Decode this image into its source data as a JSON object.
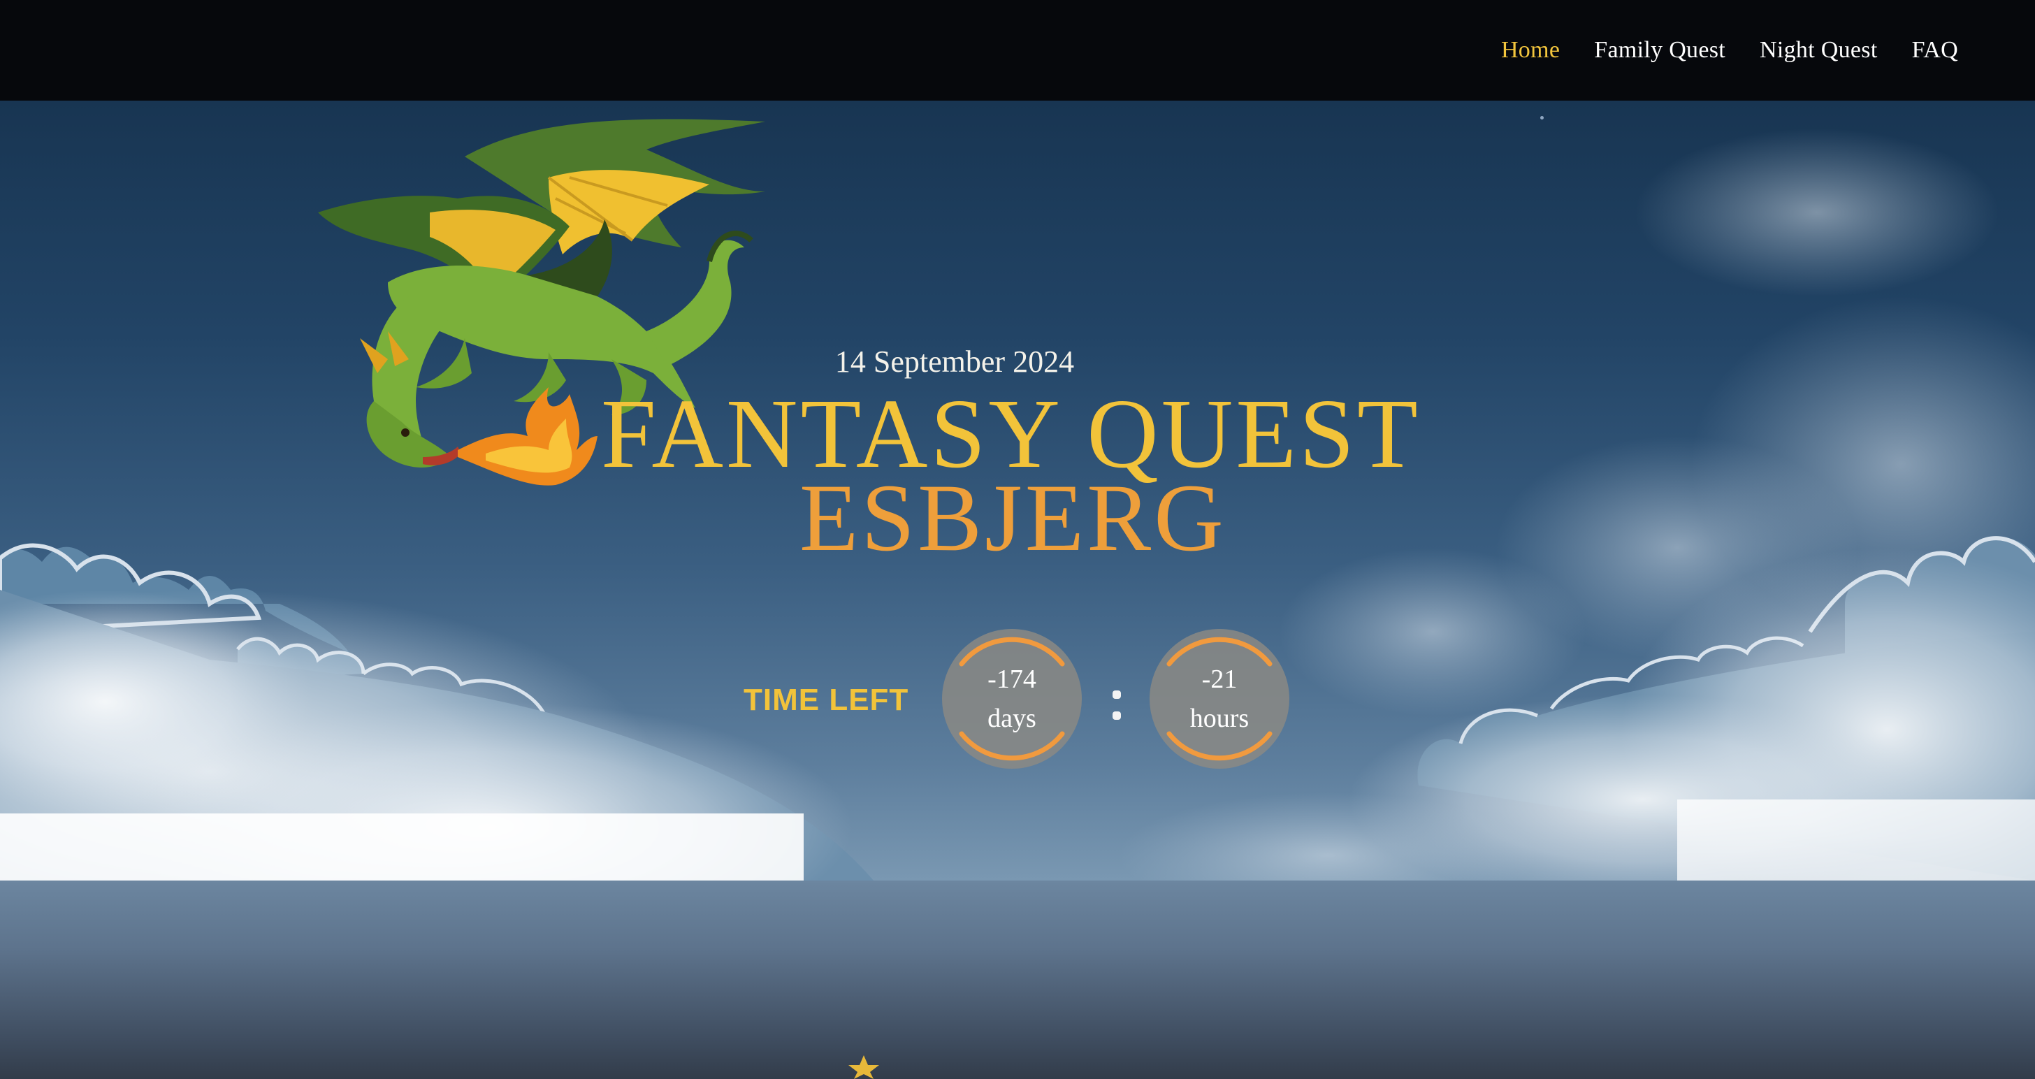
{
  "nav": {
    "items": [
      {
        "label": "Home",
        "active": true
      },
      {
        "label": "Family Quest",
        "active": false
      },
      {
        "label": "Night Quest",
        "active": false
      },
      {
        "label": "FAQ",
        "active": false
      }
    ]
  },
  "hero": {
    "date": "14 September 2024",
    "title_line1": "FANTASY QUEST",
    "title_line2": "ESBJERG",
    "countdown": {
      "label": "TIME LEFT",
      "days_value": "-174",
      "days_unit": "days",
      "separator": ":",
      "hours_value": "-21",
      "hours_unit": "hours"
    }
  },
  "colors": {
    "accent_gold": "#f2c33a",
    "accent_orange": "#ee9f3b",
    "nav_active": "#f2c53d",
    "navbar_bg": "#06080c",
    "sky_top": "#183552"
  },
  "icons": [
    "dragon-illustration",
    "star-icon"
  ]
}
